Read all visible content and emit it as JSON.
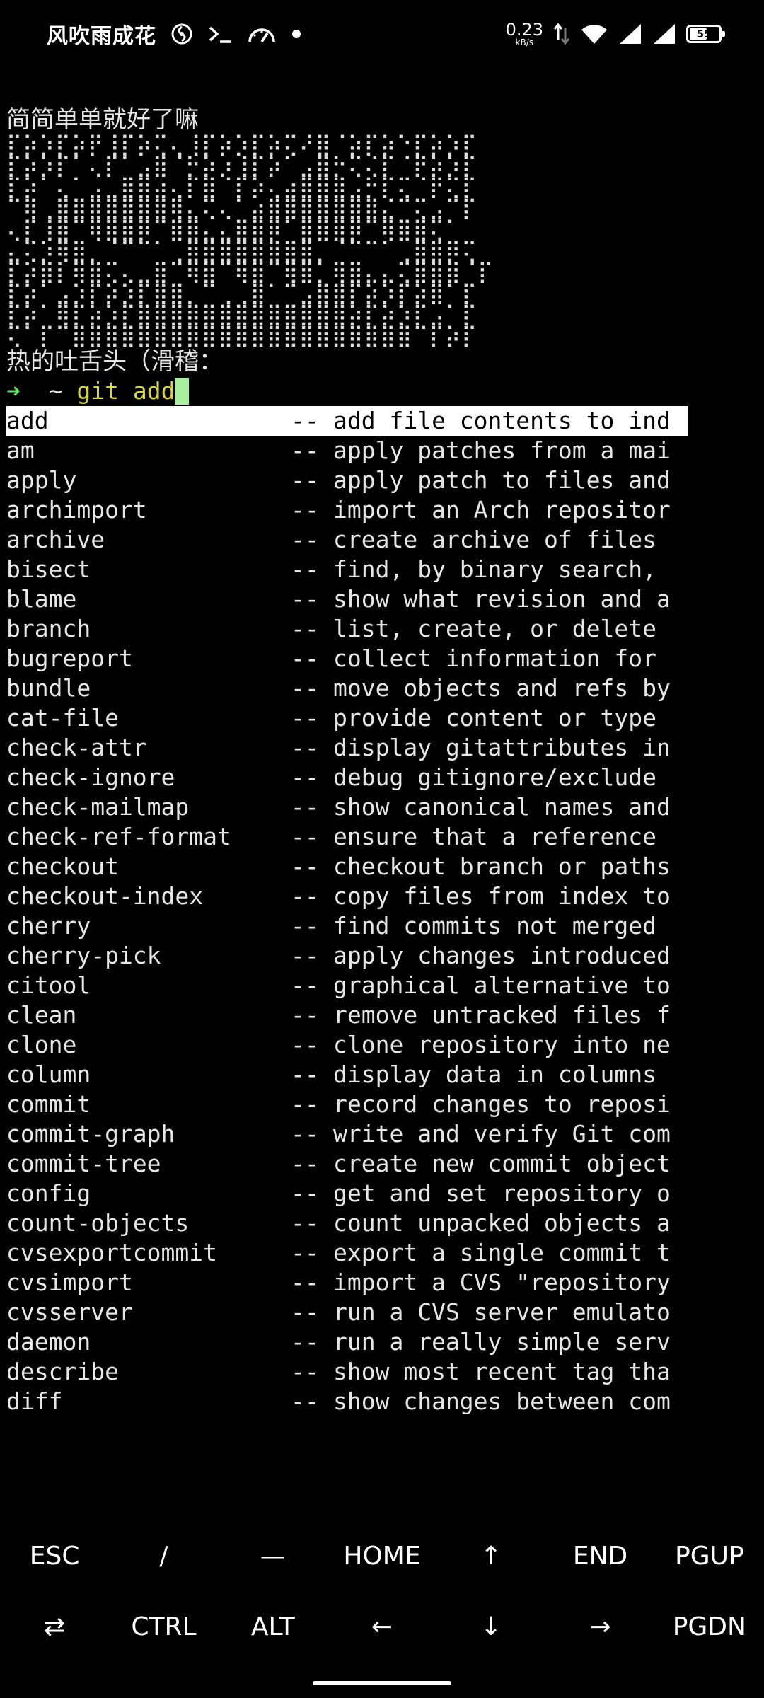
{
  "status_bar": {
    "title": "风吹雨成花",
    "net_speed_value": "0.23",
    "net_speed_unit": "kB/s",
    "battery_level": "55",
    "icons": [
      "swirl-icon",
      "terminal-icon",
      "speedometer-icon",
      "dot-icon",
      "upload-download-icon",
      "wifi-icon",
      "signal-icon",
      "signal-icon",
      "battery-icon"
    ]
  },
  "terminal": {
    "motd_line1": "简简单单就好了嘛",
    "art_lines": [
      "⡏⡵⡱⡏⡵⡟⢸⡏⡵⢍⢄⢸⡏⡵⡱⡏⡵⢍⠜⣿⠈⡵⡏⡵⠑⡏⡵⡱⡏",
      "⡏⡵⡱⡏⠁⢄⡏⠁⣠⣿⠈⡓⡵⡰⢸⡏⡵⠁⣠⣿⡓⢍⢌⡏⠈⡟⡵⡱⡏",
      "⡏⡵⠁⢄⠁⣠⣀⣿⣿⣴⢄⡏⣿⠈⡏⡵⢄⣴⣿⣿⣿⣠⡓⡏⢍⠈⡟⢍⡏",
      "⠉⢿⢀⣿⣿⣿⣿⣿⣿⣿⢿⣄⢍⢄⠁⣴⣿⣿⣿⣿⣿⣿⣿⣌⠉⢍⣠⠉⡏",
      "⢄⡏⢸⣿⠉⢿⣿⣿⡿⠉⣿⣿⣄⣄⣿⣿⡿⠁⣿⣿⣿⡿⠉⢿⣿⣿⢍⠁",
      "⣄⢍⡱⢿⣿⡀⠈⠉⠉⠁⢀⣿⣿⣿⣿⣿⣿⣿⣿⡀⠈⠉⠉⠁⢀⣿⣿⡿⢍",
      "⡏⡵⣿⡇⢿⣿⢍⢄⣀⣿⠉⢿⣿⠉⢿⣿⠉⢿⣿⡁⢿⣿⣄⣄⢍⣿⣿⣿⠈⡏",
      "⡏⡵⠁⣠⡱⡏⡵⡱⡏⣿⣿⡀⠉⢀⢀⣿⠁⠉⣠⣿⣿⡏⡵⡱⡏⡵⣿⠁⡏",
      "⡏⡵⠁⢿⡏⡵⡱⡏⣿⣿⣿⣿⣿⣿⣿⣿⣿⣿⣿⣿⣿⡵⡏⡵⡱⡏⣠⠁⡏",
      "⢍⠁⡏⠉⣿⣿⣿⣿⣿⣿⣿⣿⣿⣿⣿⣿⣿⣿⣿⣿⣿⣿⣿⣿⣿⠉⡏⡵⡏"
    ],
    "motd_line2": "热的吐舌头（滑稽：",
    "prompt_arrow": "➜",
    "prompt_cwd": "~",
    "prompt_command": "git add",
    "completions": [
      {
        "name": "add",
        "sep": "--",
        "desc": "add file contents to ind"
      },
      {
        "name": "am",
        "sep": "--",
        "desc": "apply patches from a mai"
      },
      {
        "name": "apply",
        "sep": "--",
        "desc": "apply patch to files and"
      },
      {
        "name": "archimport",
        "sep": "--",
        "desc": "import an Arch repositor"
      },
      {
        "name": "archive",
        "sep": "--",
        "desc": "create archive of files"
      },
      {
        "name": "bisect",
        "sep": "--",
        "desc": "find, by binary search,"
      },
      {
        "name": "blame",
        "sep": "--",
        "desc": "show what revision and a"
      },
      {
        "name": "branch",
        "sep": "--",
        "desc": "list, create, or delete"
      },
      {
        "name": "bugreport",
        "sep": "--",
        "desc": "collect information for"
      },
      {
        "name": "bundle",
        "sep": "--",
        "desc": "move objects and refs by"
      },
      {
        "name": "cat-file",
        "sep": "--",
        "desc": "provide content or type"
      },
      {
        "name": "check-attr",
        "sep": "--",
        "desc": "display gitattributes in"
      },
      {
        "name": "check-ignore",
        "sep": "--",
        "desc": "debug gitignore/exclude"
      },
      {
        "name": "check-mailmap",
        "sep": "--",
        "desc": "show canonical names and"
      },
      {
        "name": "check-ref-format",
        "sep": "--",
        "desc": "ensure that a reference"
      },
      {
        "name": "checkout",
        "sep": "--",
        "desc": "checkout branch or paths"
      },
      {
        "name": "checkout-index",
        "sep": "--",
        "desc": "copy files from index to"
      },
      {
        "name": "cherry",
        "sep": "--",
        "desc": "find commits not merged"
      },
      {
        "name": "cherry-pick",
        "sep": "--",
        "desc": "apply changes introduced"
      },
      {
        "name": "citool",
        "sep": "--",
        "desc": "graphical alternative to"
      },
      {
        "name": "clean",
        "sep": "--",
        "desc": "remove untracked files f"
      },
      {
        "name": "clone",
        "sep": "--",
        "desc": "clone repository into ne"
      },
      {
        "name": "column",
        "sep": "--",
        "desc": "display data in columns"
      },
      {
        "name": "commit",
        "sep": "--",
        "desc": "record changes to reposi"
      },
      {
        "name": "commit-graph",
        "sep": "--",
        "desc": "write and verify Git com"
      },
      {
        "name": "commit-tree",
        "sep": "--",
        "desc": "create new commit object"
      },
      {
        "name": "config",
        "sep": "--",
        "desc": "get and set repository o"
      },
      {
        "name": "count-objects",
        "sep": "--",
        "desc": "count unpacked objects a"
      },
      {
        "name": "cvsexportcommit",
        "sep": "--",
        "desc": "export a single commit t"
      },
      {
        "name": "cvsimport",
        "sep": "--",
        "desc": "import a CVS \"repository"
      },
      {
        "name": "cvsserver",
        "sep": "--",
        "desc": "run a CVS server emulato"
      },
      {
        "name": "daemon",
        "sep": "--",
        "desc": "run a really simple serv"
      },
      {
        "name": "describe",
        "sep": "--",
        "desc": "show most recent tag tha"
      },
      {
        "name": "diff",
        "sep": "--",
        "desc": "show changes between com"
      }
    ],
    "selected_index": 0
  },
  "extra_keys": {
    "row1": [
      "ESC",
      "/",
      "—",
      "HOME",
      "↑",
      "END",
      "PGUP"
    ],
    "row2": [
      "⇄",
      "CTRL",
      "ALT",
      "←",
      "↓",
      "→",
      "PGDN"
    ]
  },
  "colors": {
    "prompt_arrow": "#5ee65e",
    "command": "#d7d34a",
    "cursor": "#a8f0a0",
    "selection_bg": "#ffffff"
  }
}
